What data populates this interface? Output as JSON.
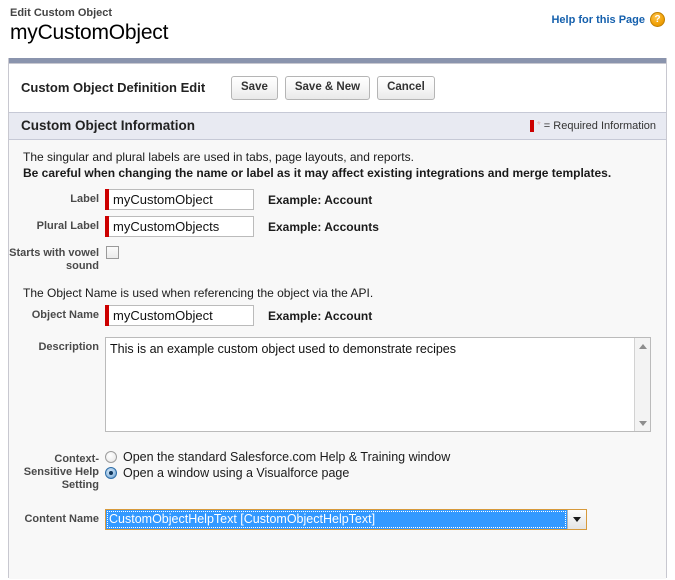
{
  "header": {
    "breadcrumb": "Edit Custom Object",
    "title": "myCustomObject",
    "help_link": "Help for this Page",
    "help_icon": "question-mark-icon",
    "help_icon_glyph": "?",
    "help_link_color": "#1560ad",
    "help_icon_color": "#f1a208"
  },
  "edit_bar": {
    "title": "Custom Object Definition Edit",
    "buttons": [
      {
        "label": "Save",
        "name": "save-button"
      },
      {
        "label": "Save & New",
        "name": "save-and-new-button"
      },
      {
        "label": "Cancel",
        "name": "cancel-button"
      }
    ]
  },
  "section": {
    "title": "Custom Object Information",
    "required_legend": "= Required Information",
    "required_asterisk": "*",
    "required_color": "#cc0000",
    "header_bg": "#e8eaf2"
  },
  "intro": {
    "line1": "The singular and plural labels are used in tabs, page layouts, and reports.",
    "line2": "Be careful when changing the name or label as it may affect existing integrations and merge templates."
  },
  "fields": {
    "label": {
      "label": "Label",
      "value": "myCustomObject",
      "example": "Example:  Account",
      "required": true
    },
    "plural_label": {
      "label": "Plural Label",
      "value": "myCustomObjects",
      "example": "Example:  Accounts",
      "required": true
    },
    "vowel": {
      "label": "Starts with vowel sound",
      "checked": false
    },
    "api_note": "The Object Name is used when referencing the object via the API.",
    "object_name": {
      "label": "Object Name",
      "value": "myCustomObject",
      "example": "Example:  Account",
      "required": true
    },
    "description": {
      "label": "Description",
      "value": "This is an example custom object used to demonstrate recipes"
    },
    "help_setting": {
      "label": "Context-Sensitive Help Setting",
      "options": [
        {
          "label": "Open the standard Salesforce.com Help & Training window",
          "selected": false
        },
        {
          "label": "Open a window using a Visualforce page",
          "selected": true
        }
      ]
    },
    "content_name": {
      "label": "Content Name",
      "value": "CustomObjectHelpText [CustomObjectHelpText]",
      "highlight_color": "#3399ff"
    }
  }
}
